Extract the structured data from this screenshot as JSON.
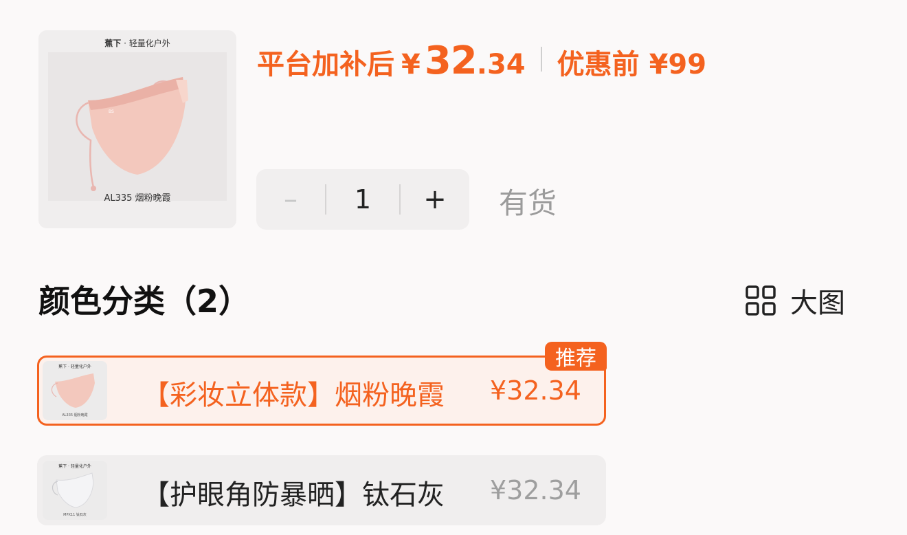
{
  "product": {
    "brand_bold": "蕉下",
    "brand_rest": "· 轻量化户外",
    "caption": "AL335 烟粉晚霞"
  },
  "price": {
    "label": "平台加补后",
    "currency": "¥",
    "integer": "32",
    "decimal": ".34",
    "original": "优惠前 ¥99",
    "accent_color": "#f4621f"
  },
  "stepper": {
    "minus": "–",
    "quantity": "1",
    "plus": "+"
  },
  "stock_status": "有货",
  "section": {
    "title": "颜色分类（2）",
    "view_label": "大图",
    "view_icon": "grid-icon"
  },
  "options": [
    {
      "label": "【彩妆立体款】烟粉晚霞",
      "price": "¥32.34",
      "badge": "推荐",
      "thumb_brand": "蕉下 · 轻量化户外",
      "thumb_caption": "AL335 烟粉晚霞",
      "selected": true
    },
    {
      "label": "【护眼角防暴晒】钛石灰",
      "price": "¥32.34",
      "thumb_brand": "蕉下 · 轻量化户外",
      "thumb_caption": "MPX11 钛石灰",
      "selected": false
    }
  ]
}
